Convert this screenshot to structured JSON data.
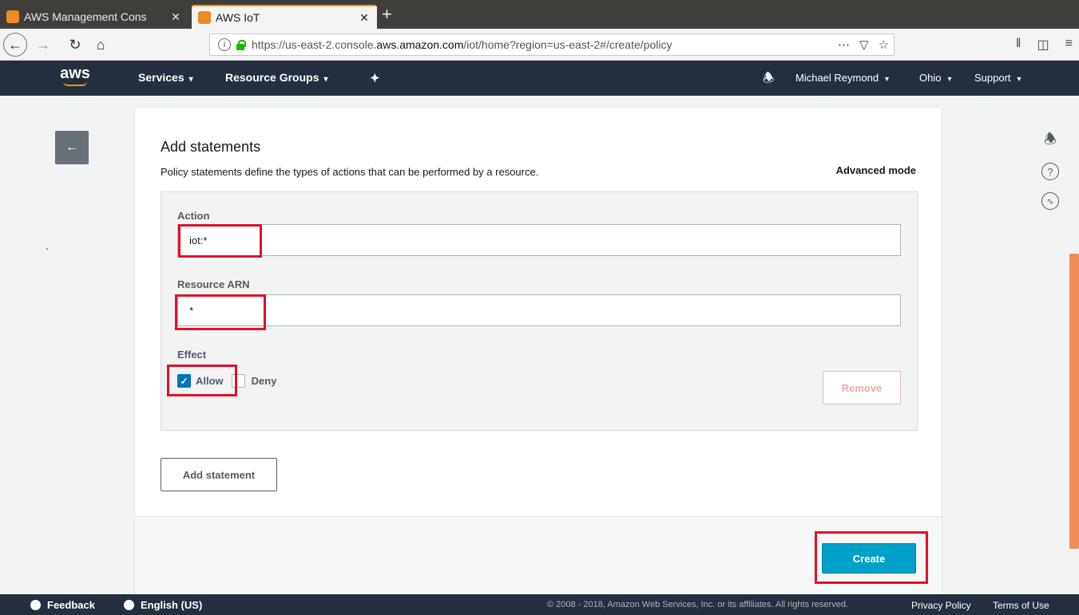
{
  "browser": {
    "tabs": [
      {
        "title": "AWS Management Cons",
        "close": "✕"
      },
      {
        "title": "AWS IoT",
        "close": "✕"
      }
    ],
    "new_tab": "+",
    "url_prefix": "https://us-east-2.console.",
    "url_host": "aws.amazon.com",
    "url_suffix": "/iot/home?region=us-east-2#/create/policy",
    "url_icons": [
      "more-icon",
      "pocket-icon",
      "star-icon"
    ],
    "right_icons": [
      "library-icon",
      "sidebar-icon",
      "menu-icon"
    ]
  },
  "console_header": {
    "logo": "aws",
    "services": "Services",
    "resource_groups": "Resource Groups",
    "user": "Michael Reymond",
    "region": "Ohio",
    "support": "Support",
    "caret": "▾"
  },
  "statements": {
    "title": "Add statements",
    "description": "Policy statements define the types of actions that can be performed by a resource.",
    "advanced_mode": "Advanced mode",
    "action_label": "Action",
    "action_value": "iot:*",
    "resource_label": "Resource ARN",
    "resource_value": "*",
    "effect_label": "Effect",
    "allow_label": "Allow",
    "allow_checked": true,
    "deny_label": "Deny",
    "deny_checked": false,
    "remove_label": "Remove",
    "add_statement_label": "Add statement",
    "create_label": "Create"
  },
  "page": {
    "back_arrow": "←",
    "stray_dot": "."
  },
  "footer": {
    "feedback": "Feedback",
    "language": "English (US)",
    "copyright": "© 2008 - 2018, Amazon Web Services, Inc. or its affiliates. All rights reserved.",
    "privacy": "Privacy Policy",
    "terms": "Terms of Use"
  },
  "colors": {
    "console_bg": "#232f3e",
    "primary_button": "#00a1c9",
    "highlight": "#e0102a",
    "scroll_thumb": "#ef8c57"
  }
}
